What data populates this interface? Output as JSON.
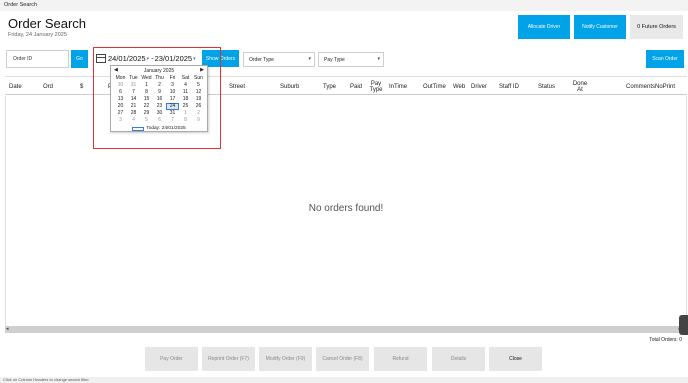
{
  "window": {
    "title": "Order Search"
  },
  "header": {
    "title": "Order Search",
    "date": "Friday, 24 January 2025",
    "buttons": {
      "allocate_driver": "Allocate Driver",
      "notify_customer": "Notify Customer",
      "future_orders": "0 Future Orders"
    }
  },
  "filters": {
    "order_id_placeholder": "Order ID",
    "go": "Go",
    "date_from": "24/01/2025",
    "date_sep": "-",
    "date_to": "23/01/2025",
    "show_orders": "Show Orders",
    "order_type": "Order Type",
    "pay_type": "Pay Type",
    "scan_order": "Scan Order"
  },
  "calendar": {
    "month_label": "January 2025",
    "prev": "◀",
    "next": "▶",
    "weekdays": [
      "Mon",
      "Tue",
      "Wed",
      "Thu",
      "Fri",
      "Sat",
      "Sun"
    ],
    "weeks": [
      [
        "30",
        "31",
        "1",
        "2",
        "3",
        "4",
        "5"
      ],
      [
        "6",
        "7",
        "8",
        "9",
        "10",
        "11",
        "12"
      ],
      [
        "13",
        "14",
        "15",
        "16",
        "17",
        "18",
        "19"
      ],
      [
        "20",
        "21",
        "22",
        "23",
        "24",
        "25",
        "26"
      ],
      [
        "27",
        "28",
        "29",
        "30",
        "31",
        "1",
        "2"
      ],
      [
        "3",
        "4",
        "5",
        "6",
        "7",
        "8",
        "9"
      ]
    ],
    "selected": "24",
    "today_label": "Today: 24/01/2025"
  },
  "columns": [
    "Date",
    "Ord",
    "$",
    "P",
    "Street",
    "Suburb",
    "Type",
    "Paid",
    "Pay Type",
    "InTime",
    "OutTime",
    "Web",
    "Driver",
    "Staff ID",
    "Status",
    "Done At",
    "Comments",
    "NoPrint"
  ],
  "empty_message": "No orders found!",
  "total_orders": "Total Orders: 0",
  "footer_buttons": [
    "Pay Order",
    "Reprint Order (F7)",
    "Modify Order (F9)",
    "Cancel Order (F8)",
    "Refund",
    "Details",
    "Close"
  ],
  "status_text": "Click on Column Headers to change search filter",
  "colors": {
    "accent": "#00a2e8",
    "highlight": "#e03030",
    "selected_day": "#3a7bd5"
  }
}
